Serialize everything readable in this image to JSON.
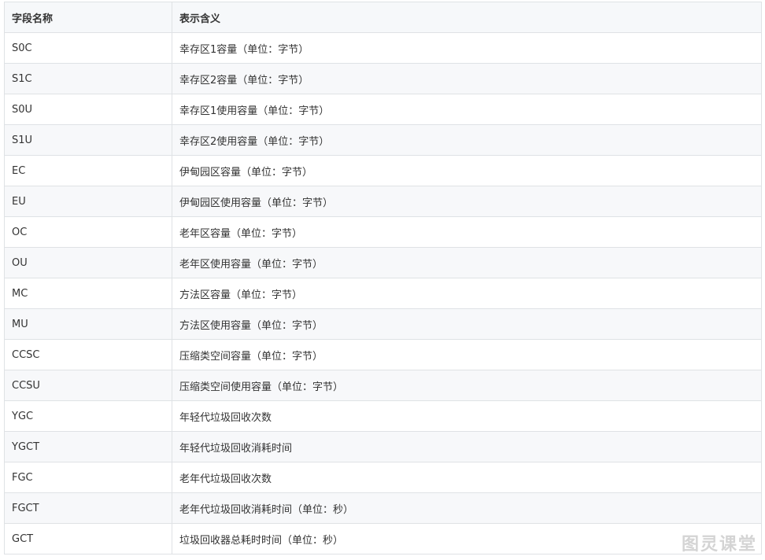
{
  "table": {
    "headers": [
      "字段名称",
      "表示含义"
    ],
    "rows": [
      [
        "S0C",
        "幸存区1容量（单位：字节）"
      ],
      [
        "S1C",
        "幸存区2容量（单位：字节）"
      ],
      [
        "S0U",
        "幸存区1使用容量（单位：字节）"
      ],
      [
        "S1U",
        "幸存区2使用容量（单位：字节）"
      ],
      [
        "EC",
        "伊甸园区容量（单位：字节）"
      ],
      [
        "EU",
        "伊甸园区使用容量（单位：字节）"
      ],
      [
        "OC",
        "老年区容量（单位：字节）"
      ],
      [
        "OU",
        "老年区使用容量（单位：字节）"
      ],
      [
        "MC",
        "方法区容量（单位：字节）"
      ],
      [
        "MU",
        "方法区使用容量（单位：字节）"
      ],
      [
        "CCSC",
        "压缩类空间容量（单位：字节）"
      ],
      [
        "CCSU",
        "压缩类空间使用容量（单位：字节）"
      ],
      [
        "YGC",
        "年轻代垃圾回收次数"
      ],
      [
        "YGCT",
        "年轻代垃圾回收消耗时间"
      ],
      [
        "FGC",
        "老年代垃圾回收次数"
      ],
      [
        "FGCT",
        "老年代垃圾回收消耗时间（单位：秒）"
      ],
      [
        "GCT",
        "垃圾回收器总耗时时间（单位：秒）"
      ]
    ]
  },
  "watermark": "图灵课堂"
}
